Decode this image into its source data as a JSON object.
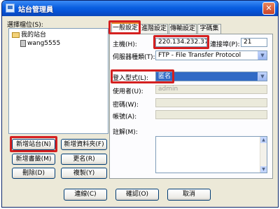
{
  "window": {
    "title": "站台管理員",
    "close_glyph": "✕"
  },
  "sidebar": {
    "select_label": "選擇檔位(S):",
    "tree": {
      "root": "我的站台",
      "child": "wang5555"
    },
    "buttons": {
      "new_site": "新增站台(N)",
      "new_folder": "新增資料夾(F)",
      "new_bookmark": "新增書籤(M)",
      "rename": "更名(R)",
      "delete": "刪除(D)",
      "copy": "複製(Y)"
    }
  },
  "tabs": [
    {
      "label": "一般設定",
      "active": true
    },
    {
      "label": "進階設定",
      "active": false
    },
    {
      "label": "傳輸設定",
      "active": false
    },
    {
      "label": "字碼集",
      "active": false
    }
  ],
  "form": {
    "host_label": "主機(H):",
    "host_value": "220.134.232.37",
    "port_label": "連接埠(P):",
    "port_value": "21",
    "server_type_label": "伺服器種類(T):",
    "server_type_value": "FTP - File Transfer Protocol",
    "login_type_label": "登入型式(L):",
    "login_type_value": "匿名",
    "user_label": "使用者(U):",
    "user_value": "admin",
    "password_label": "密碼(W):",
    "account_label": "帳號(A):",
    "comment_label": "註解(M):"
  },
  "footer": {
    "connect": "連線(C)",
    "ok": "確認(O)",
    "cancel": "取消"
  },
  "colors": {
    "highlight_border": "#d42020",
    "selection": "#316ac5",
    "title_bar": "#0a5fe0"
  }
}
